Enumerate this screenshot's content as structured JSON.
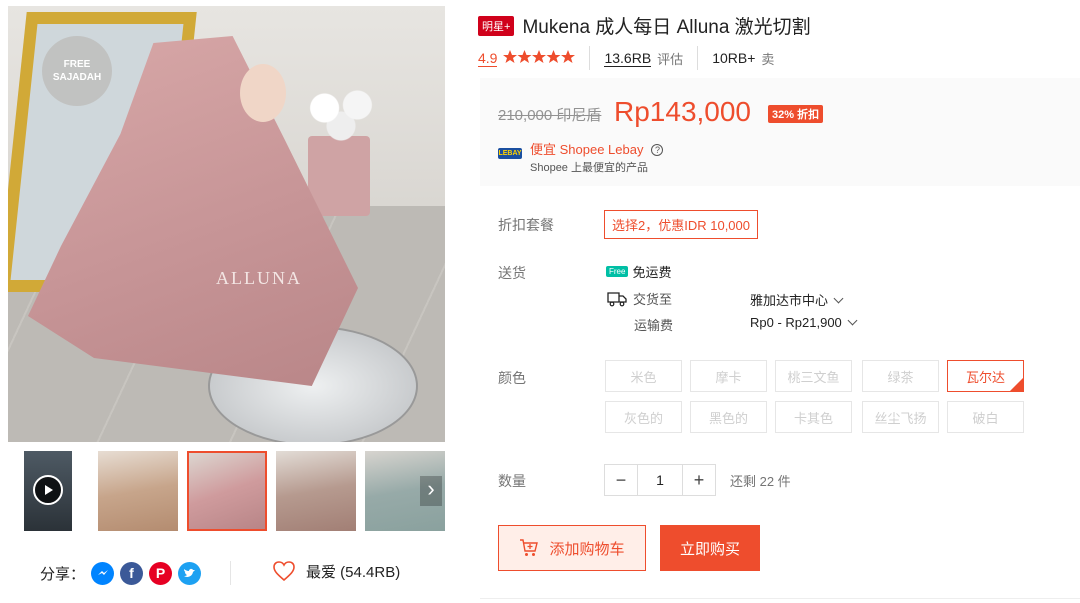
{
  "colors": {
    "brand": "#ee4d2d",
    "badge": "#d0011b",
    "gold": "#d1a937"
  },
  "gallery": {
    "badge_line1": "FREE",
    "badge_line2": "SAJADAH",
    "watermark": "ALLUNA",
    "thumbs": [
      "video",
      "mukena-beige",
      "mukena-pink",
      "mukena-dusty",
      "mukena-sage"
    ]
  },
  "share": {
    "label": "分享：",
    "icons": [
      "messenger-icon",
      "facebook-icon",
      "pinterest-icon",
      "twitter-icon"
    ],
    "fav_label": "最爱 (54.4RB)"
  },
  "product": {
    "badge": "明星+",
    "title": "Mukena 成人每日 Alluna 激光切割",
    "rating": "4.9",
    "stars": 5,
    "reviews_count": "13.6RB",
    "reviews_label": "评估",
    "sold_count": "10RB+",
    "sold_label": "卖"
  },
  "price": {
    "original": "210,000 印尼盾",
    "current": "Rp143,000",
    "discount": "32% 折扣",
    "lebay_logo": "LEBAY",
    "lebay_title": "便宜 Shopee Lebay",
    "lebay_sub": "Shopee 上最便宜的产品"
  },
  "combo": {
    "label": "折扣套餐",
    "value": "选择2，优惠IDR 10,000"
  },
  "shipping": {
    "label": "送货",
    "free_tag": "Free",
    "free_label": "免运费",
    "deliver_label": "交货至",
    "deliver_value": "雅加达市中心",
    "fee_label": "运输费",
    "fee_value": "Rp0 - Rp21,900"
  },
  "colors_section": {
    "label": "颜色",
    "options": [
      "米色",
      "摩卡",
      "桃三文鱼",
      "绿茶",
      "瓦尔达",
      "灰色的",
      "黑色的",
      "卡其色",
      "丝尘飞扬",
      "破白"
    ],
    "selected_index": 4
  },
  "quantity": {
    "label": "数量",
    "minus": "−",
    "value": "1",
    "plus": "+",
    "stock": "还剩 22 件"
  },
  "actions": {
    "add_to_cart": "添加购物车",
    "buy_now": "立即购买"
  }
}
